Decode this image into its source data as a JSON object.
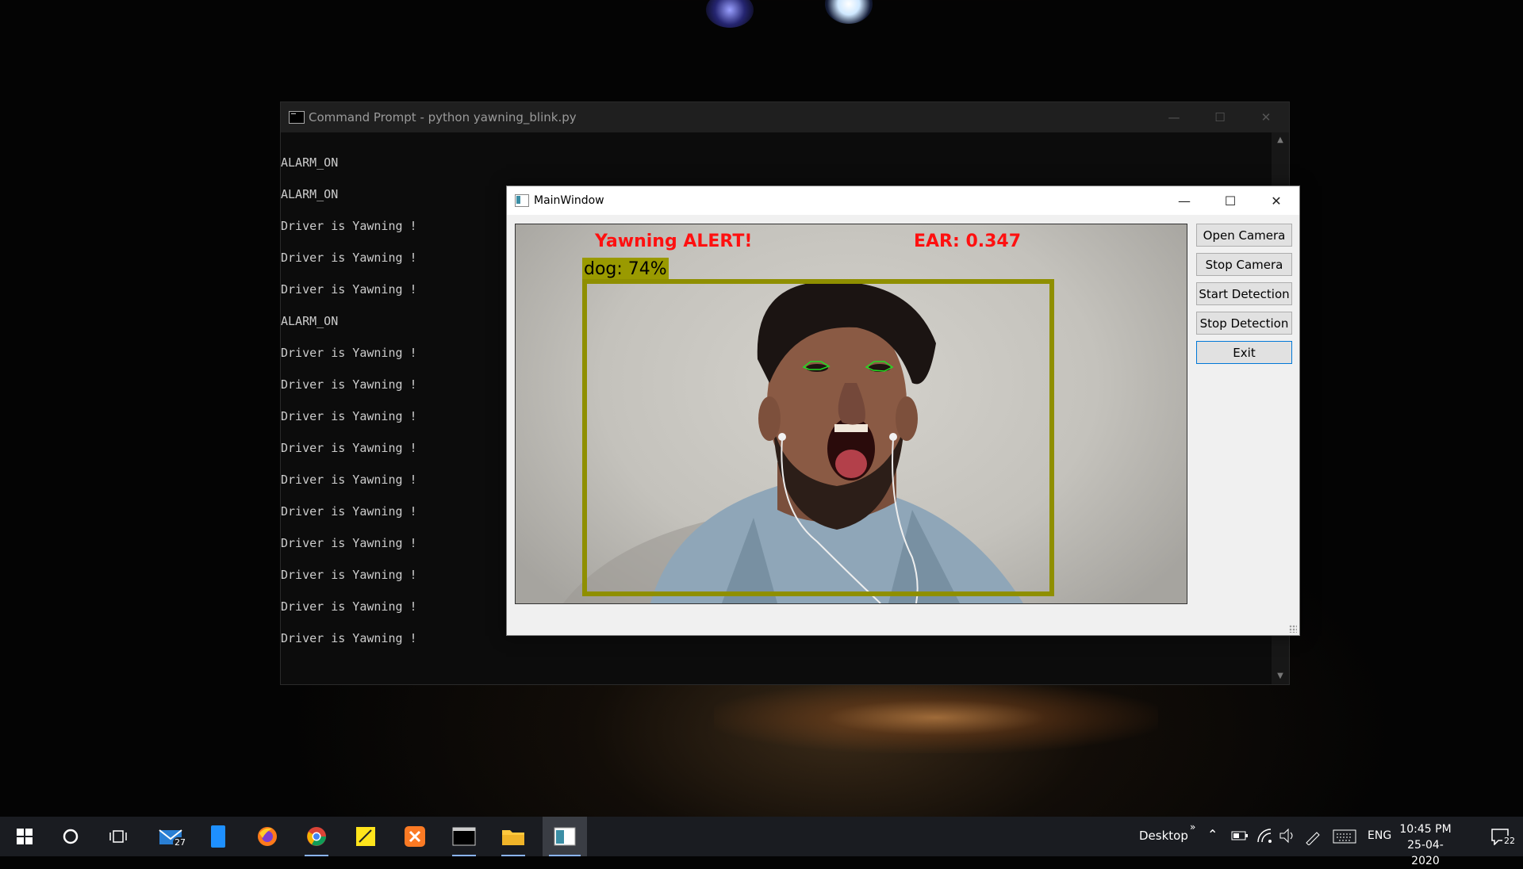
{
  "cmd": {
    "title": "Command Prompt - python  yawning_blink.py",
    "lines": [
      "ALARM_ON",
      "ALARM_ON",
      "Driver is Yawning !",
      "Driver is Yawning !",
      "Driver is Yawning !",
      "ALARM_ON",
      "Driver is Yawning !",
      "Driver is Yawning !",
      "Driver is Yawning !",
      "Driver is Yawning !",
      "Driver is Yawning !",
      "Driver is Yawning !",
      "Driver is Yawning !",
      "Driver is Yawning !",
      "Driver is Yawning !",
      "Driver is Yawning !"
    ]
  },
  "main_window": {
    "title": "MainWindow",
    "video": {
      "alert_text": "Yawning ALERT!",
      "ear_text": "EAR: 0.347",
      "detection_label": "dog: 74%"
    },
    "buttons": {
      "open_camera": "Open Camera",
      "stop_camera": "Stop Camera",
      "start_detection": "Start Detection",
      "stop_detection": "Stop Detection",
      "exit": "Exit"
    }
  },
  "taskbar": {
    "mail_badge": "27",
    "desktop_label": "Desktop",
    "language": "ENG",
    "time": "10:45 PM",
    "date": "25-04-2020",
    "notification_count": "22",
    "colors": {
      "accent": "#8ab4ff",
      "background": "#1a1c21"
    }
  }
}
